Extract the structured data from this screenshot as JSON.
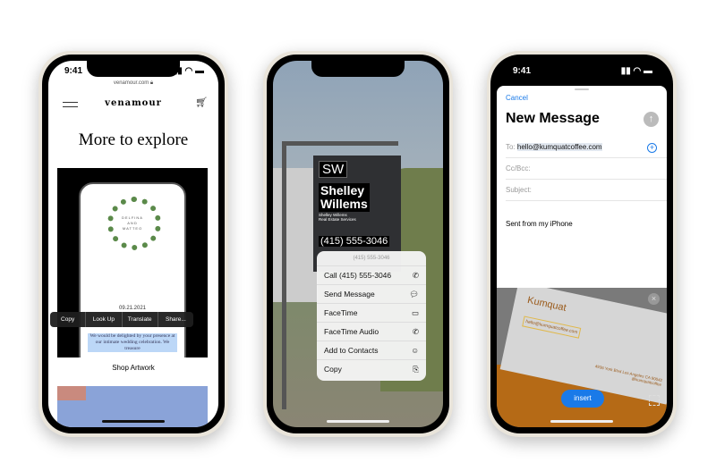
{
  "phone1": {
    "time": "9:41",
    "url": "venamour.com",
    "brand": "venamour",
    "heading": "More to explore",
    "invite": {
      "names": [
        "DELFINA",
        "AND",
        "MATTEO"
      ],
      "date": "09.21.2021",
      "selected_text": "We would be delighted by your presence at our intimate wedding celebration. We treasure"
    },
    "context_menu": [
      "Copy",
      "Look Up",
      "Translate",
      "Share..."
    ],
    "link": "Shop Artwork"
  },
  "phone2": {
    "sign": {
      "logo": "SW",
      "name_line1": "Shelley",
      "name_line2": "Willems",
      "sub1": "Shelley Willems",
      "sub2": "Real Estate Services",
      "phone": "(415) 555-3046"
    },
    "menu": {
      "header": "(415) 555-3046",
      "items": [
        {
          "label": "Call (415) 555-3046",
          "icon": "phone-icon"
        },
        {
          "label": "Send Message",
          "icon": "message-icon"
        },
        {
          "label": "FaceTime",
          "icon": "video-icon"
        },
        {
          "label": "FaceTime Audio",
          "icon": "phone-icon"
        },
        {
          "label": "Add to Contacts",
          "icon": "add-contact-icon"
        },
        {
          "label": "Copy",
          "icon": "copy-icon"
        }
      ]
    }
  },
  "phone3": {
    "time": "9:41",
    "cancel": "Cancel",
    "title": "New Message",
    "to_label": "To:",
    "to_value": "hello@kumquatcoffee.com",
    "cc_label": "Cc/Bcc:",
    "subject_label": "Subject:",
    "body": "Sent from my iPhone",
    "card": {
      "name": "Kumquat",
      "email": "hello@kumquatcoffee.com",
      "address": "4936 York Blvd Los Angeles CA 90042",
      "handle": "@kumquatcoffee"
    },
    "insert": "insert",
    "accent": "#1a7ae8"
  }
}
